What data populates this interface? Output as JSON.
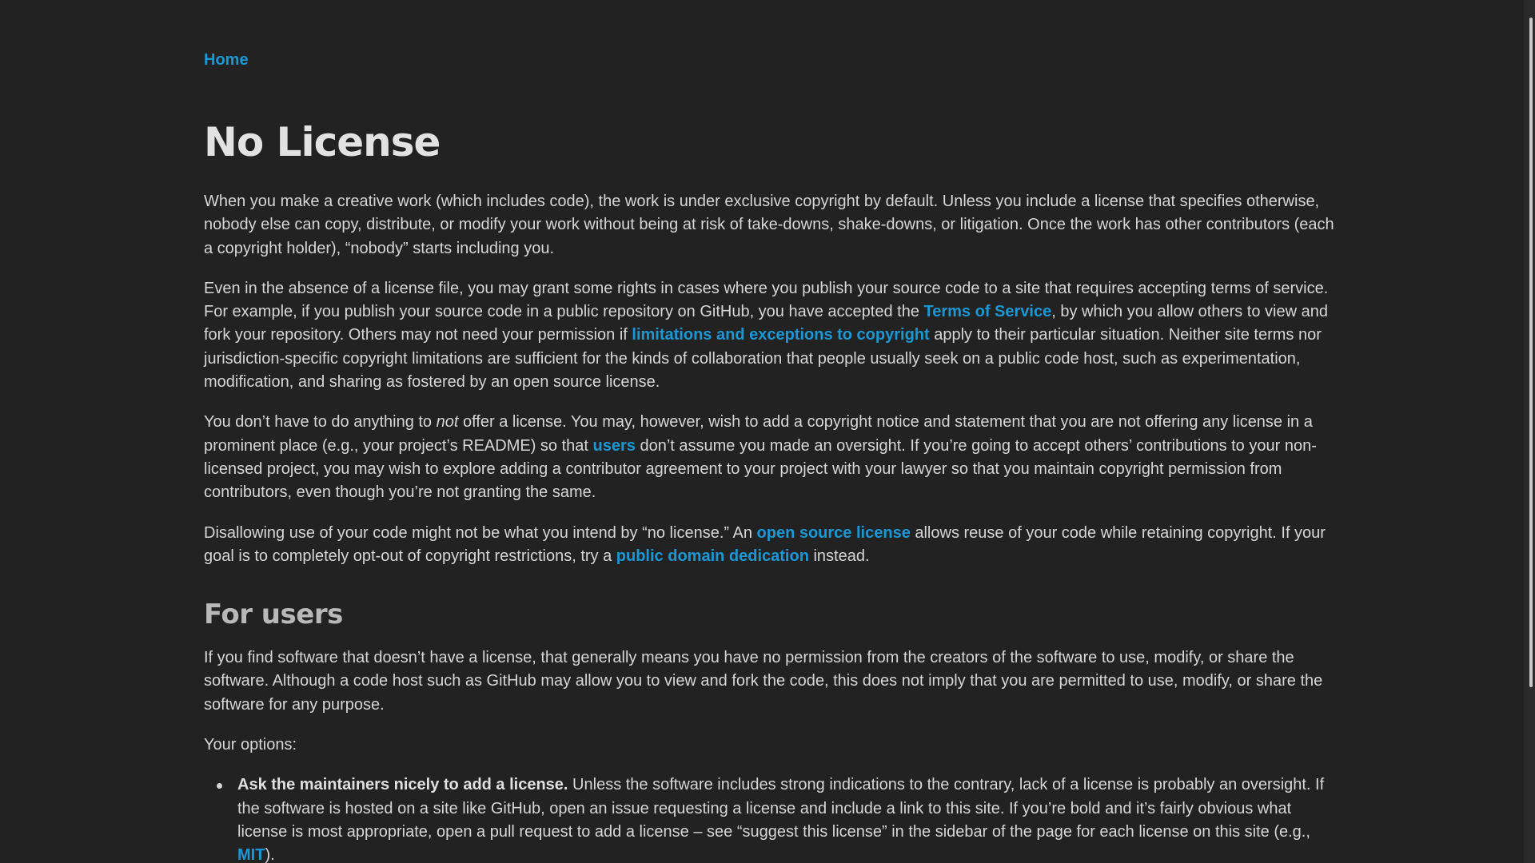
{
  "breadcrumb": {
    "home": "Home"
  },
  "title": "No License",
  "intro": {
    "p1": "When you make a creative work (which includes code), the work is under exclusive copyright by default. Unless you include a license that specifies otherwise, nobody else can copy, distribute, or modify your work without being at risk of take-downs, shake-downs, or litigation. Once the work has other contributors (each a copyright holder), “nobody” starts including you.",
    "p2_a": "Even in the absence of a license file, you may grant some rights in cases where you publish your source code to a site that requires accepting terms of service. For example, if you publish your source code in a public repository on GitHub, you have accepted the ",
    "p2_link1": "Terms of Service",
    "p2_b": ", by which you allow others to view and fork your repository. Others may not need your permission if ",
    "p2_link2": "limitations and exceptions to copyright",
    "p2_c": " apply to their particular situation. Neither site terms nor jurisdiction-specific copyright limitations are sufficient for the kinds of collaboration that people usually seek on a public code host, such as experimentation, modification, and sharing as fostered by an open source license.",
    "p3_a": "You don’t have to do anything to ",
    "p3_em": "not",
    "p3_b": " offer a license. You may, however, wish to add a copyright notice and statement that you are not offering any license in a prominent place (e.g., your project’s README) so that ",
    "p3_link": "users",
    "p3_c": " don’t assume you made an oversight. If you’re going to accept others’ contributions to your non-licensed project, you may wish to explore adding a contributor agreement to your project with your lawyer so that you maintain copyright permission from contributors, even though you’re not granting the same.",
    "p4_a": "Disallowing use of your code might not be what you intend by “no license.” An ",
    "p4_link1": "open source license",
    "p4_b": " allows reuse of your code while retaining copyright. If your goal is to completely opt-out of copyright restrictions, try a ",
    "p4_link2": "public domain dedication",
    "p4_c": " instead."
  },
  "for_users": {
    "heading": "For users",
    "p1": "If you find software that doesn’t have a license, that generally means you have no permission from the creators of the software to use, modify, or share the software. Although a code host such as GitHub may allow you to view and fork the code, this does not imply that you are permitted to use, modify, or share the software for any purpose.",
    "options_label": "Your options:",
    "option1_bold": "Ask the maintainers nicely to add a license.",
    "option1_a": " Unless the software includes strong indications to the contrary, lack of a license is probably an oversight. If the software is hosted on a site like GitHub, open an issue requesting a license and include a link to this site. If you’re bold and it’s fairly obvious what license is most appropriate, open a pull request to add a license – see “suggest this license” in the sidebar of the page for each license on this site (e.g., ",
    "option1_link": "MIT",
    "option1_b": ")."
  },
  "colors": {
    "background": "#222222",
    "text": "#d6d6d6",
    "link": "#1a98d6"
  }
}
